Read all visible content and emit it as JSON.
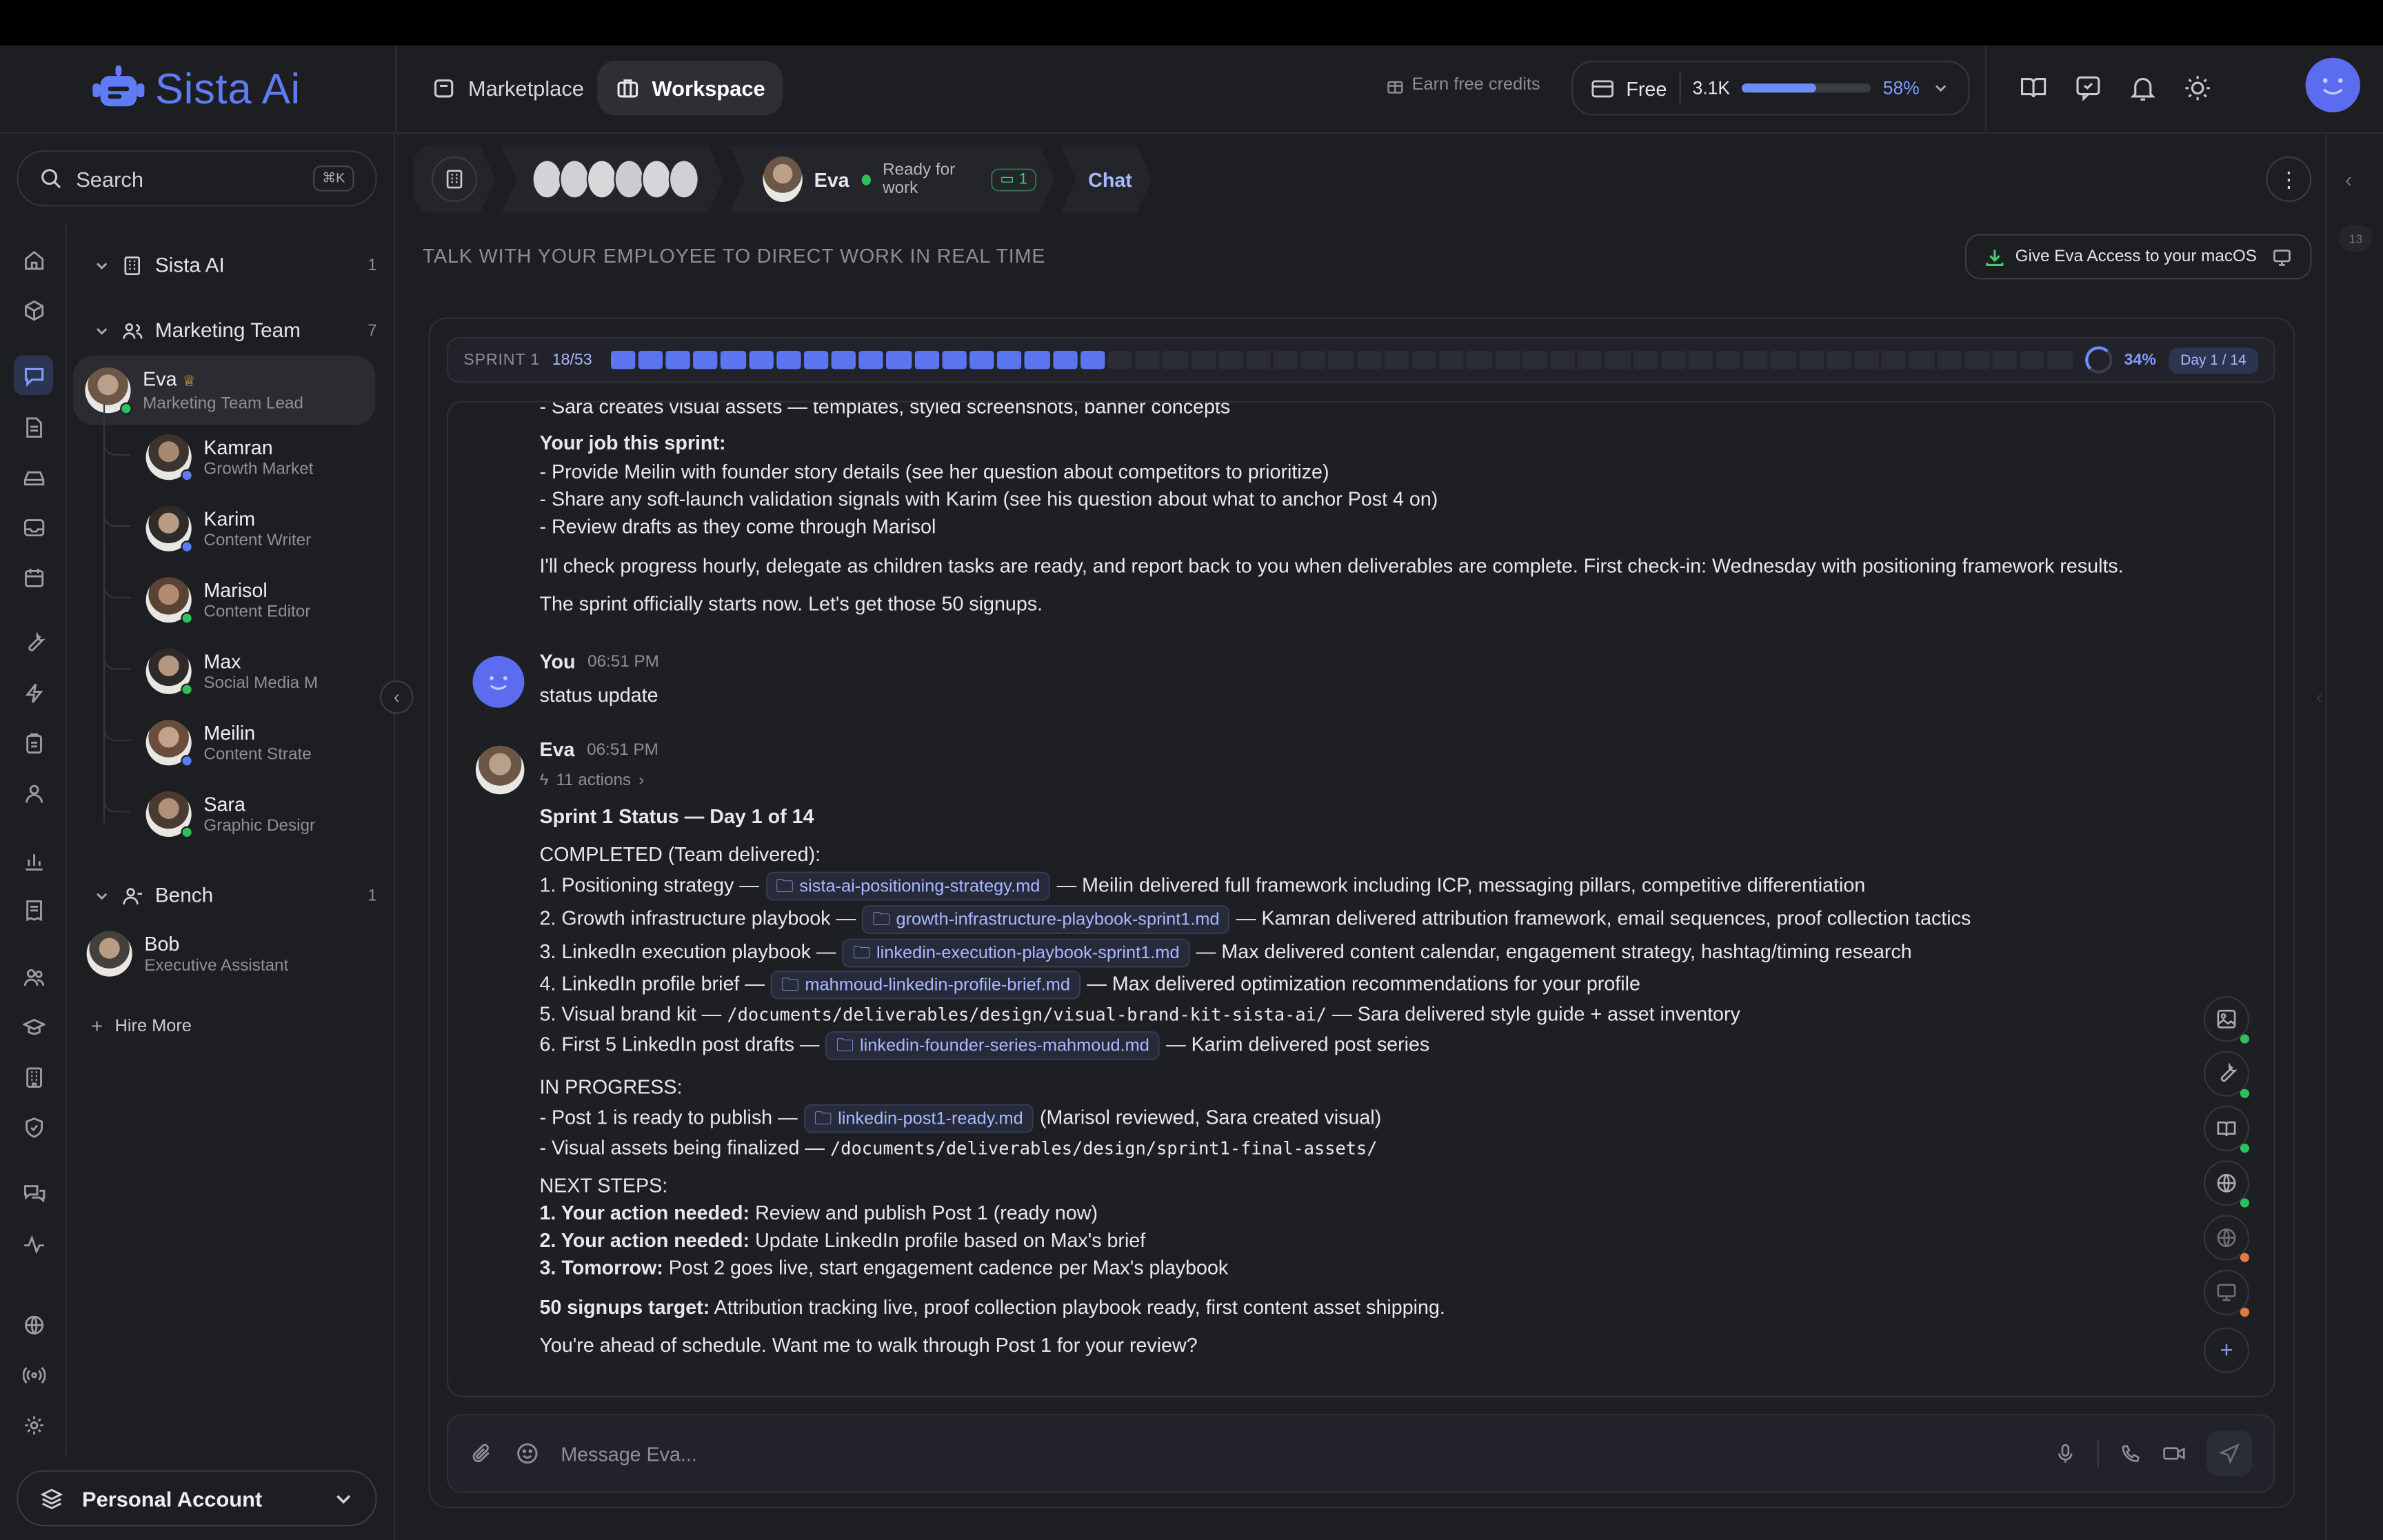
{
  "brand": {
    "name": "Sista Ai",
    "accent": "#5f7cf6"
  },
  "header": {
    "nav": [
      {
        "label": "Marketplace",
        "icon": "store-icon"
      },
      {
        "label": "Workspace",
        "icon": "briefcase-icon"
      }
    ],
    "earn_credits": "Earn free credits",
    "plan": {
      "name": "Free",
      "credits": "3.1K",
      "usage_percent": "58%",
      "usage_fraction": 0.58
    }
  },
  "sidebar": {
    "search_label": "Search",
    "search_shortcut": "⌘K",
    "company": {
      "name": "Sista AI",
      "count": "1"
    },
    "team": {
      "name": "Marketing Team",
      "count": "7"
    },
    "lead": {
      "name": "Eva",
      "role": "Marketing Team Lead"
    },
    "members": [
      {
        "name": "Kamran",
        "role": "Growth Market",
        "status": "blue"
      },
      {
        "name": "Karim",
        "role": "Content Writer",
        "status": "blue"
      },
      {
        "name": "Marisol",
        "role": "Content Editor",
        "status": "green"
      },
      {
        "name": "Max",
        "role": "Social Media M",
        "status": "green"
      },
      {
        "name": "Meilin",
        "role": "Content Strate",
        "status": "blue"
      },
      {
        "name": "Sara",
        "role": "Graphic Desigr",
        "status": "green"
      }
    ],
    "bench": {
      "name": "Bench",
      "count": "1"
    },
    "bench_member": {
      "name": "Bob",
      "role": "Executive Assistant"
    },
    "hire_more": "Hire More",
    "account": "Personal Account"
  },
  "breadcrumb": {
    "employee": "Eva",
    "status": "Ready for work",
    "task_count": "1",
    "view": "Chat"
  },
  "subtitle": "TALK WITH YOUR EMPLOYEE TO DIRECT WORK IN REAL TIME",
  "macos_button": "Give Eva Access to your macOS",
  "sprint": {
    "label": "SPRINT 1",
    "progress": "18/53",
    "done": 18,
    "total": 53,
    "percent": "34%",
    "day": "Day 1 / 14"
  },
  "chat": {
    "prev": {
      "cutoff": "- Sara creates visual assets — templates, styled screenshots, banner concepts",
      "job_title": "Your job this sprint:",
      "job_lines": [
        "- Provide Meilin with founder story details (see her question about competitors to prioritize)",
        "- Share any soft-launch validation signals with Karim (see his question about what to anchor Post 4 on)",
        "- Review drafts as they come through Marisol"
      ],
      "p1": "I'll check progress hourly, delegate as children tasks are ready, and report back to you when deliverables are complete. First check-in: Wednesday with positioning framework results.",
      "p2": "The sprint officially starts now. Let's get those 50 signups."
    },
    "user_msg": {
      "sender": "You",
      "time": "06:51 PM",
      "text": "status update"
    },
    "eva_msg": {
      "sender": "Eva",
      "time": "06:51 PM",
      "actions": "11 actions",
      "title": "Sprint 1 Status — Day 1 of 14",
      "completed_title": "COMPLETED (Team delivered):",
      "completed": [
        {
          "prefix": "1. Positioning strategy —",
          "file": "sista-ai-positioning-strategy.md",
          "suffix": "— Meilin delivered full framework including ICP, messaging pillars, competitive differentiation"
        },
        {
          "prefix": "2. Growth infrastructure playbook —",
          "file": "growth-infrastructure-playbook-sprint1.md",
          "suffix": "— Kamran delivered attribution framework, email sequences, proof collection tactics"
        },
        {
          "prefix": "3. LinkedIn execution playbook —",
          "file": "linkedin-execution-playbook-sprint1.md",
          "suffix": "— Max delivered content calendar, engagement strategy, hashtag/timing research"
        },
        {
          "prefix": "4. LinkedIn profile brief —",
          "file": "mahmoud-linkedin-profile-brief.md",
          "suffix": "— Max delivered optimization recommendations for your profile"
        },
        {
          "prefix": "5. Visual brand kit —",
          "path": "/documents/deliverables/design/visual-brand-kit-sista-ai/",
          "suffix": "— Sara delivered style guide + asset inventory"
        },
        {
          "prefix": "6. First 5 LinkedIn post drafts —",
          "file": "linkedin-founder-series-mahmoud.md",
          "suffix": "— Karim delivered post series"
        }
      ],
      "progress_title": "IN PROGRESS:",
      "progress_1": {
        "prefix": "- Post 1 is ready to publish —",
        "file": "linkedin-post1-ready.md",
        "suffix": "(Marisol reviewed, Sara created visual)"
      },
      "progress_2": {
        "prefix": "- Visual assets being finalized —",
        "path": "/documents/deliverables/design/sprint1-final-assets/"
      },
      "next_title": "NEXT STEPS:",
      "next": [
        {
          "lead": "1. Your action needed:",
          "text": "Review and publish Post 1 (ready now)"
        },
        {
          "lead": "2. Your action needed:",
          "text": "Update LinkedIn profile based on Max's brief"
        },
        {
          "lead": "3. Tomorrow:",
          "text": "Post 2 goes live, start engagement cadence per Max's playbook"
        }
      ],
      "target_lead": "50 signups target:",
      "target_text": "Attribution tracking live, proof collection playbook ready, first content asset shipping.",
      "closing": "You're ahead of schedule. Want me to walk through Post 1 for your review?"
    }
  },
  "composer": {
    "placeholder": "Message Eva..."
  },
  "right_rail_badge": "13"
}
